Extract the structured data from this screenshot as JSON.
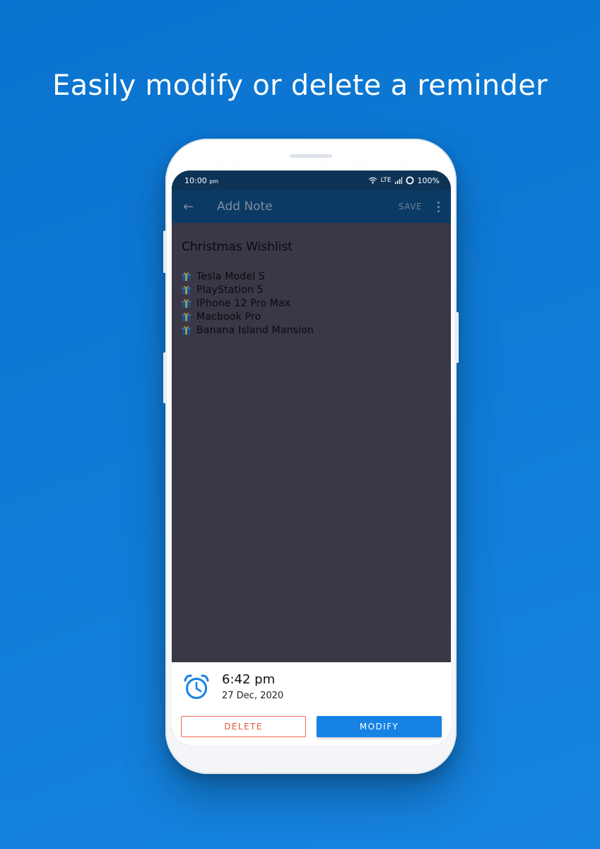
{
  "headline": "Easily modify or delete a reminder",
  "status_bar": {
    "time": "10:00",
    "time_suffix": "pm",
    "network": "LTE",
    "battery": "100%"
  },
  "app_bar": {
    "title": "Add Note",
    "save_label": "SAVE"
  },
  "note": {
    "title": "Christmas Wishlist",
    "items": [
      "Tesla Model S",
      "PlayStation 5",
      "IPhone 12 Pro Max",
      "Macbook Pro",
      "Banana Island Mansion"
    ]
  },
  "reminder": {
    "time": "6:42 pm",
    "date": "27 Dec, 2020"
  },
  "actions": {
    "delete_label": "DELETE",
    "modify_label": "MODIFY"
  },
  "colors": {
    "background": "#0f7bd6",
    "app_bar": "#0b3a64",
    "note_bg": "#3b3746",
    "accent": "#1682e4",
    "delete": "#e0593c"
  },
  "icons": [
    "back-arrow-icon",
    "more-vert-icon",
    "wifi-icon",
    "signal-icon",
    "battery-icon",
    "gift-icon",
    "alarm-clock-icon"
  ]
}
